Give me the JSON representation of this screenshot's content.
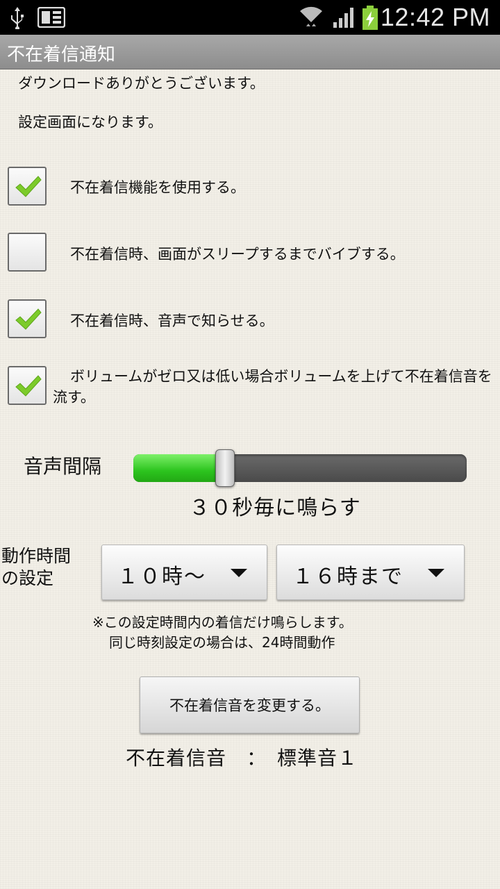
{
  "status_bar": {
    "time": "12:42 PM",
    "icons": [
      "usb-icon",
      "ebook-icon",
      "wifi-icon",
      "signal-icon",
      "battery-charging-icon"
    ]
  },
  "app_title": "不在着信通知",
  "intro": {
    "line1": "ダウンロードありがとうございます。",
    "line2": "設定画面になります。"
  },
  "options": [
    {
      "label": "不在着信機能を使用する。",
      "checked": true
    },
    {
      "label": "不在着信時、画面がスリープするまでバイブする。",
      "checked": false
    },
    {
      "label": "不在着信時、音声で知らせる。",
      "checked": true
    },
    {
      "label": "ボリュームがゼロ又は低い場合ボリュームを上げて不在着信音を流す。",
      "checked": true
    }
  ],
  "slider": {
    "label": "音声間隔",
    "value_text": "３０秒毎に鳴らす",
    "fraction": 0.27
  },
  "time_setting": {
    "label_line1": "動作時間",
    "label_line2": "の設定",
    "start": "１０時～",
    "end": "１６時まで",
    "note1": "※この設定時間内の着信だけ鳴らします。",
    "note2": "同じ時刻設定の場合は、24時間動作"
  },
  "change_button": "不在着信音を変更する。",
  "ringtone": {
    "text": "不在着信音　：　標準音１"
  },
  "colors": {
    "accent_green": "#2cc41e",
    "checkmark_green": "#7ccb2a",
    "titlebar": "#999999"
  }
}
